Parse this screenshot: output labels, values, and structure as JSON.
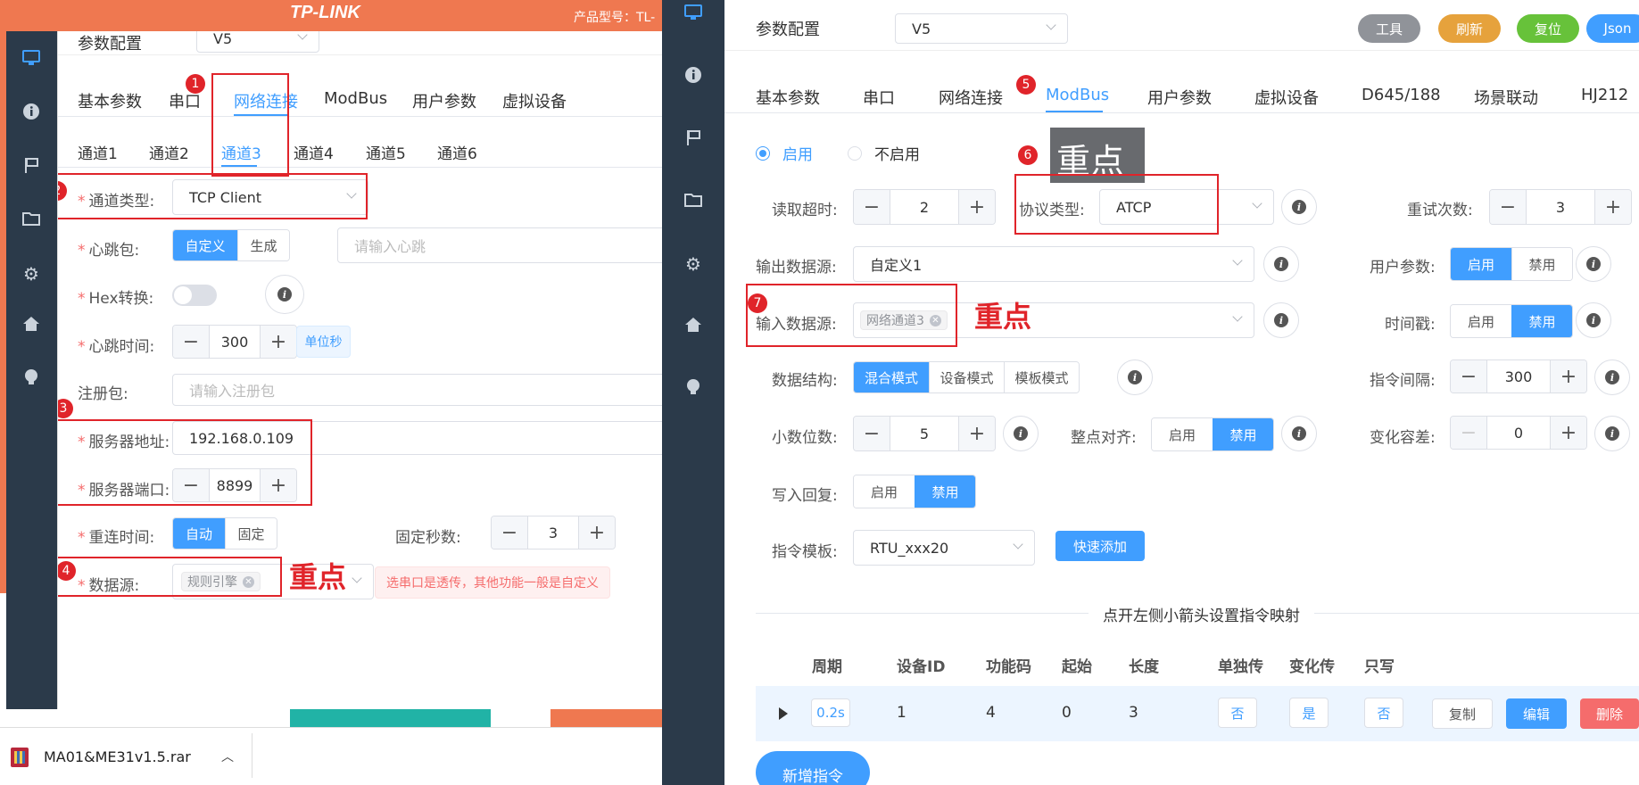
{
  "background": {
    "logo": "TP-LINK",
    "model": "产品型号：TL-"
  },
  "download": {
    "file_name": "MA01&ME31v1.5.rar"
  },
  "left": {
    "title": "参数配置",
    "version": "V5",
    "tabs": [
      "基本参数",
      "串口",
      "网络连接",
      "ModBus",
      "用户参数",
      "虚拟设备"
    ],
    "channels": [
      "通道1",
      "通道2",
      "通道3",
      "通道4",
      "通道5",
      "通道6"
    ],
    "channel_type": {
      "label": "通道类型:",
      "value": "TCP Client"
    },
    "heartbeat": {
      "label": "心跳包:",
      "options": [
        "自定义",
        "生成"
      ],
      "placeholder": "请输入心跳"
    },
    "hex": {
      "label": "Hex转换:"
    },
    "heartbeat_time": {
      "label": "心跳时间:",
      "value": "300",
      "unit": "单位秒"
    },
    "register": {
      "label": "注册包:",
      "placeholder": "请输入注册包"
    },
    "server_addr": {
      "label": "服务器地址:",
      "value": "192.168.0.109"
    },
    "server_port": {
      "label": "服务器端口:",
      "value": "8899"
    },
    "reconnect": {
      "label": "重连时间:",
      "options": [
        "自动",
        "固定"
      ]
    },
    "fixed_seconds": {
      "label": "固定秒数:",
      "value": "3"
    },
    "data_source": {
      "label": "数据源:",
      "tag": "规则引擎",
      "hint": "选串口是透传，其他功能一般是自定义"
    },
    "badges": [
      "1",
      "2",
      "3",
      "4"
    ],
    "focus": "重点"
  },
  "right": {
    "title": "参数配置",
    "version": "V5",
    "buttons": {
      "tools": "工具",
      "refresh": "刷新",
      "reset": "复位",
      "json": "Json"
    },
    "tabs": [
      "基本参数",
      "串口",
      "网络连接",
      "ModBus",
      "用户参数",
      "虚拟设备",
      "D645/188",
      "场景联动",
      "HJ212"
    ],
    "enable": {
      "on": "启用",
      "off": "不启用"
    },
    "read_timeout": {
      "label": "读取超时:",
      "value": "2"
    },
    "protocol": {
      "label": "协议类型:",
      "value": "ATCP"
    },
    "retry": {
      "label": "重试次数:",
      "value": "3"
    },
    "output_source": {
      "label": "输出数据源:",
      "value": "自定义1"
    },
    "user_param": {
      "label": "用户参数:",
      "options": [
        "启用",
        "禁用"
      ]
    },
    "input_source": {
      "label": "输入数据源:",
      "tag": "网络通道3"
    },
    "timestamp": {
      "label": "时间戳:",
      "options": [
        "启用",
        "禁用"
      ]
    },
    "data_struct": {
      "label": "数据结构:",
      "options": [
        "混合模式",
        "设备模式",
        "模板模式"
      ]
    },
    "cmd_interval": {
      "label": "指令间隔:",
      "value": "300"
    },
    "decimals": {
      "label": "小数位数:",
      "value": "5"
    },
    "align": {
      "label": "整点对齐:",
      "options": [
        "启用",
        "禁用"
      ]
    },
    "tolerance": {
      "label": "变化容差:",
      "value": "0"
    },
    "write_reply": {
      "label": "写入回复:",
      "options": [
        "启用",
        "禁用"
      ]
    },
    "cmd_template": {
      "label": "指令模板:",
      "value": "RTU_xxx20"
    },
    "quick_add": "快速添加",
    "divider_text": "点开左侧小箭头设置指令映射",
    "table": {
      "headers": [
        "周期",
        "设备ID",
        "功能码",
        "起始",
        "长度",
        "单独传",
        "变化传",
        "只写"
      ],
      "row": {
        "period": "0.2s",
        "device_id": "1",
        "func": "4",
        "start": "0",
        "length": "3",
        "solo": "否",
        "change": "是",
        "write_only": "否"
      },
      "actions": {
        "copy": "复制",
        "edit": "编辑",
        "delete": "删除"
      }
    },
    "add_cmd": "新增指令",
    "badges": [
      "5",
      "6",
      "7"
    ],
    "tooltip": "重点",
    "focus": "重点"
  },
  "colors": {
    "primary": "#409eff",
    "danger": "#f56c6c",
    "annotation": "#e0242a",
    "sidebar": "#2b3a4a"
  }
}
